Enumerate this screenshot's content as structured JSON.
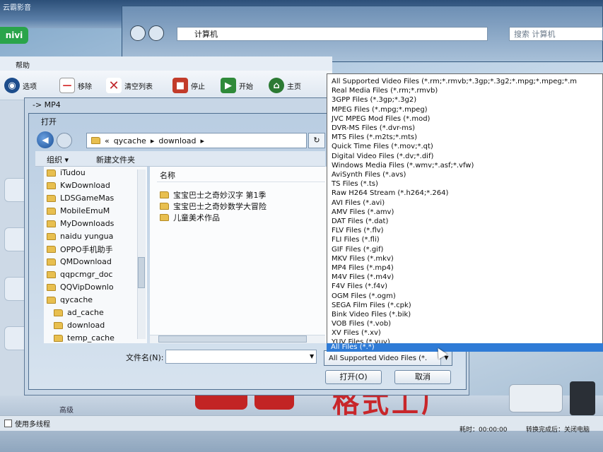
{
  "background_app": {
    "title_fragment": "云霸影音",
    "logo": "nivi",
    "menu_help": "帮助",
    "toolbar": [
      {
        "label": "选项",
        "icon": "options-icon",
        "color": "#1d4d8c"
      },
      {
        "label": "移除",
        "icon": "remove-icon",
        "color": "#d42b2b"
      },
      {
        "label": "清空列表",
        "icon": "clear-list-icon",
        "color": "#c0262b"
      },
      {
        "label": "停止",
        "icon": "stop-icon",
        "color": "#c23b2a"
      },
      {
        "label": "开始",
        "icon": "start-icon",
        "color": "#2f8a3a"
      },
      {
        "label": "主页",
        "icon": "home-icon",
        "color": "#2c7a33"
      }
    ],
    "status": {
      "multithread": "使用多线程",
      "elapsed": "耗时：00:00:00",
      "after_convert": "转换完成后：关闭电脑"
    },
    "banner": "格式工厂",
    "bottom_left": "高级"
  },
  "explorer": {
    "address": "计算机",
    "search_placeholder": "搜索 计算机"
  },
  "mp4_dialog": {
    "title": "-> MP4"
  },
  "open_dialog": {
    "title": "打开",
    "breadcrumb": [
      "qycache",
      "download"
    ],
    "organize": "组织 ▾",
    "new_folder": "新建文件夹",
    "column_name": "名称",
    "nav_items": [
      "iTudou",
      "KwDownload",
      "LDSGameMas",
      "MobileEmuM",
      "MyDownloads",
      "naidu yungua",
      "OPPO手机助手",
      "QMDownload",
      "qqpcmgr_doc",
      "QQVipDownlo",
      "qycache",
      "ad_cache",
      "download",
      "temp_cache"
    ],
    "files": [
      "宝宝巴士之奇妙汉字 第1季",
      "宝宝巴士之奇妙数学大冒险",
      "儿童美术作品"
    ],
    "filename_label": "文件名(N):",
    "filename_value": "",
    "filetype_selected": "All Supported Video Files (*.",
    "open_button": "打开(O)",
    "cancel_button": "取消"
  },
  "filetype_options": [
    "All Supported Video Files (*.rm;*.rmvb;*.3gp;*.3g2;*.mpg;*.mpeg;*.m",
    "Real Media Files (*.rm;*.rmvb)",
    "3GPP Files (*.3gp;*.3g2)",
    "MPEG Files (*.mpg;*.mpeg)",
    "JVC MPEG Mod Files (*.mod)",
    "DVR-MS Files (*.dvr-ms)",
    "MTS Files (*.m2ts;*.mts)",
    "Quick Time Files (*.mov;*.qt)",
    "Digital Video Files (*.dv;*.dif)",
    "Windows Media Files (*.wmv;*.asf;*.vfw)",
    "AviSynth Files (*.avs)",
    "TS Files (*.ts)",
    "Raw H264 Stream (*.h264;*.264)",
    "AVI Files (*.avi)",
    "AMV Files (*.amv)",
    "DAT Files (*.dat)",
    "FLV Files (*.flv)",
    "FLI Files (*.fli)",
    "GIF Files (*.gif)",
    "MKV Files (*.mkv)",
    "MP4 Files (*.mp4)",
    "M4V Files (*.m4v)",
    "F4V Files (*.f4v)",
    "OGM Files (*.ogm)",
    "SEGA Film Files (*.cpk)",
    "Bink Video Files (*.bik)",
    "VOB Files (*.vob)",
    "XV Files (*.xv)",
    "YUV Files (*.yuv)"
  ],
  "filetype_highlighted": "All Files (*.*)",
  "colors": {
    "selection": "#2f7bd6",
    "folder": "#e8bf4f"
  }
}
